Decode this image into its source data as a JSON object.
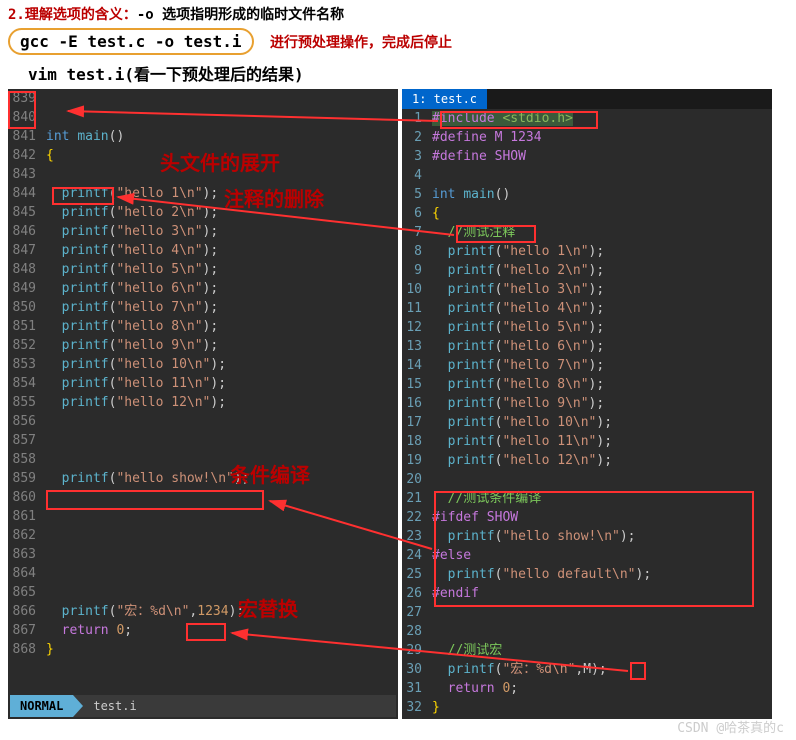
{
  "header": {
    "title_prefix": "2.理解选项的含义：",
    "title_code": "-o 选项指明形成的临时文件名称",
    "cmd": "gcc -E test.c -o test.i",
    "cmd_desc": "进行预处理操作，完成后停止",
    "vim_cmd": "vim test.i(看一下预处理后的结果)"
  },
  "annotations": {
    "a1": "头文件的展开",
    "a2": "注释的删除",
    "a3": "条件编译",
    "a4": "宏替换"
  },
  "left": {
    "status_mode": "NORMAL",
    "status_file": "test.i",
    "lines": [
      {
        "n": "839",
        "html": ""
      },
      {
        "n": "840",
        "html": ""
      },
      {
        "n": "841",
        "html": "<span class='type'>int</span> <span class='func'>main</span>()"
      },
      {
        "n": "842",
        "html": "<span class='brace'>{</span>"
      },
      {
        "n": "843",
        "html": ""
      },
      {
        "n": "844",
        "html": "  <span class='func'>printf</span>(<span class='str'>\"hello 1\\n\"</span>);"
      },
      {
        "n": "845",
        "html": "  <span class='func'>printf</span>(<span class='str'>\"hello 2\\n\"</span>);"
      },
      {
        "n": "846",
        "html": "  <span class='func'>printf</span>(<span class='str'>\"hello 3\\n\"</span>);"
      },
      {
        "n": "847",
        "html": "  <span class='func'>printf</span>(<span class='str'>\"hello 4\\n\"</span>);"
      },
      {
        "n": "848",
        "html": "  <span class='func'>printf</span>(<span class='str'>\"hello 5\\n\"</span>);"
      },
      {
        "n": "849",
        "html": "  <span class='func'>printf</span>(<span class='str'>\"hello 6\\n\"</span>);"
      },
      {
        "n": "850",
        "html": "  <span class='func'>printf</span>(<span class='str'>\"hello 7\\n\"</span>);"
      },
      {
        "n": "851",
        "html": "  <span class='func'>printf</span>(<span class='str'>\"hello 8\\n\"</span>);"
      },
      {
        "n": "852",
        "html": "  <span class='func'>printf</span>(<span class='str'>\"hello 9\\n\"</span>);"
      },
      {
        "n": "853",
        "html": "  <span class='func'>printf</span>(<span class='str'>\"hello 10\\n\"</span>);"
      },
      {
        "n": "854",
        "html": "  <span class='func'>printf</span>(<span class='str'>\"hello 11\\n\"</span>);"
      },
      {
        "n": "855",
        "html": "  <span class='func'>printf</span>(<span class='str'>\"hello 12\\n\"</span>);"
      },
      {
        "n": "856",
        "html": ""
      },
      {
        "n": "857",
        "html": ""
      },
      {
        "n": "858",
        "html": ""
      },
      {
        "n": "859",
        "html": "  <span class='func'>printf</span>(<span class='str'>\"hello show!\\n\"</span>);"
      },
      {
        "n": "860",
        "html": ""
      },
      {
        "n": "861",
        "html": ""
      },
      {
        "n": "862",
        "html": ""
      },
      {
        "n": "863",
        "html": ""
      },
      {
        "n": "864",
        "html": ""
      },
      {
        "n": "865",
        "html": ""
      },
      {
        "n": "866",
        "html": "  <span class='func'>printf</span>(<span class='str'>\"宏：%d\\n\"</span>,<span class='num'>1234</span>);"
      },
      {
        "n": "867",
        "html": "  <span class='kw'>return</span> <span class='num'>0</span>;"
      },
      {
        "n": "868",
        "html": "<span class='brace'>}</span>"
      }
    ]
  },
  "right": {
    "tab": "1: test.c",
    "lines": [
      {
        "n": "1",
        "html": "<span style='background:#3a5a3a'><span class='pre'>#include</span> <span class='inc'>&lt;stdio.h&gt;</span></span>"
      },
      {
        "n": "2",
        "html": "<span class='pre'>#define M 1234</span>"
      },
      {
        "n": "3",
        "html": "<span class='pre'>#define SHOW</span>"
      },
      {
        "n": "4",
        "html": ""
      },
      {
        "n": "5",
        "html": "<span class='type'>int</span> <span class='func'>main</span>()"
      },
      {
        "n": "6",
        "html": "<span class='brace'>{</span>"
      },
      {
        "n": "7",
        "html": "  <span class='cmt'>//测试注释</span>"
      },
      {
        "n": "8",
        "html": "  <span class='func'>printf</span>(<span class='str'>\"hello 1\\n\"</span>);"
      },
      {
        "n": "9",
        "html": "  <span class='func'>printf</span>(<span class='str'>\"hello 2\\n\"</span>);"
      },
      {
        "n": "10",
        "html": "  <span class='func'>printf</span>(<span class='str'>\"hello 3\\n\"</span>);"
      },
      {
        "n": "11",
        "html": "  <span class='func'>printf</span>(<span class='str'>\"hello 4\\n\"</span>);"
      },
      {
        "n": "12",
        "html": "  <span class='func'>printf</span>(<span class='str'>\"hello 5\\n\"</span>);"
      },
      {
        "n": "13",
        "html": "  <span class='func'>printf</span>(<span class='str'>\"hello 6\\n\"</span>);"
      },
      {
        "n": "14",
        "html": "  <span class='func'>printf</span>(<span class='str'>\"hello 7\\n\"</span>);"
      },
      {
        "n": "15",
        "html": "  <span class='func'>printf</span>(<span class='str'>\"hello 8\\n\"</span>);"
      },
      {
        "n": "16",
        "html": "  <span class='func'>printf</span>(<span class='str'>\"hello 9\\n\"</span>);"
      },
      {
        "n": "17",
        "html": "  <span class='func'>printf</span>(<span class='str'>\"hello 10\\n\"</span>);"
      },
      {
        "n": "18",
        "html": "  <span class='func'>printf</span>(<span class='str'>\"hello 11\\n\"</span>);"
      },
      {
        "n": "19",
        "html": "  <span class='func'>printf</span>(<span class='str'>\"hello 12\\n\"</span>);"
      },
      {
        "n": "20",
        "html": ""
      },
      {
        "n": "21",
        "html": "  <span class='cmt'>//测试条件编译</span>"
      },
      {
        "n": "22",
        "html": "<span class='pre'>#ifdef SHOW</span>"
      },
      {
        "n": "23",
        "html": "  <span class='func'>printf</span>(<span class='str'>\"hello show!\\n\"</span>);"
      },
      {
        "n": "24",
        "html": "<span class='pre'>#else</span>"
      },
      {
        "n": "25",
        "html": "  <span class='func'>printf</span>(<span class='str'>\"hello default\\n\"</span>);"
      },
      {
        "n": "26",
        "html": "<span class='pre'>#endif</span>"
      },
      {
        "n": "27",
        "html": ""
      },
      {
        "n": "28",
        "html": ""
      },
      {
        "n": "29",
        "html": "  <span class='cmt'>//测试宏</span>"
      },
      {
        "n": "30",
        "html": "  <span class='func'>printf</span>(<span class='str'>\"宏：%d\\n\"</span>,<span class='sym'>M</span>);"
      },
      {
        "n": "31",
        "html": "  <span class='kw'>return</span> <span class='num'>0</span>;"
      },
      {
        "n": "32",
        "html": "<span class='brace'>}</span>"
      }
    ]
  },
  "watermark": "CSDN @哈茶真的c"
}
